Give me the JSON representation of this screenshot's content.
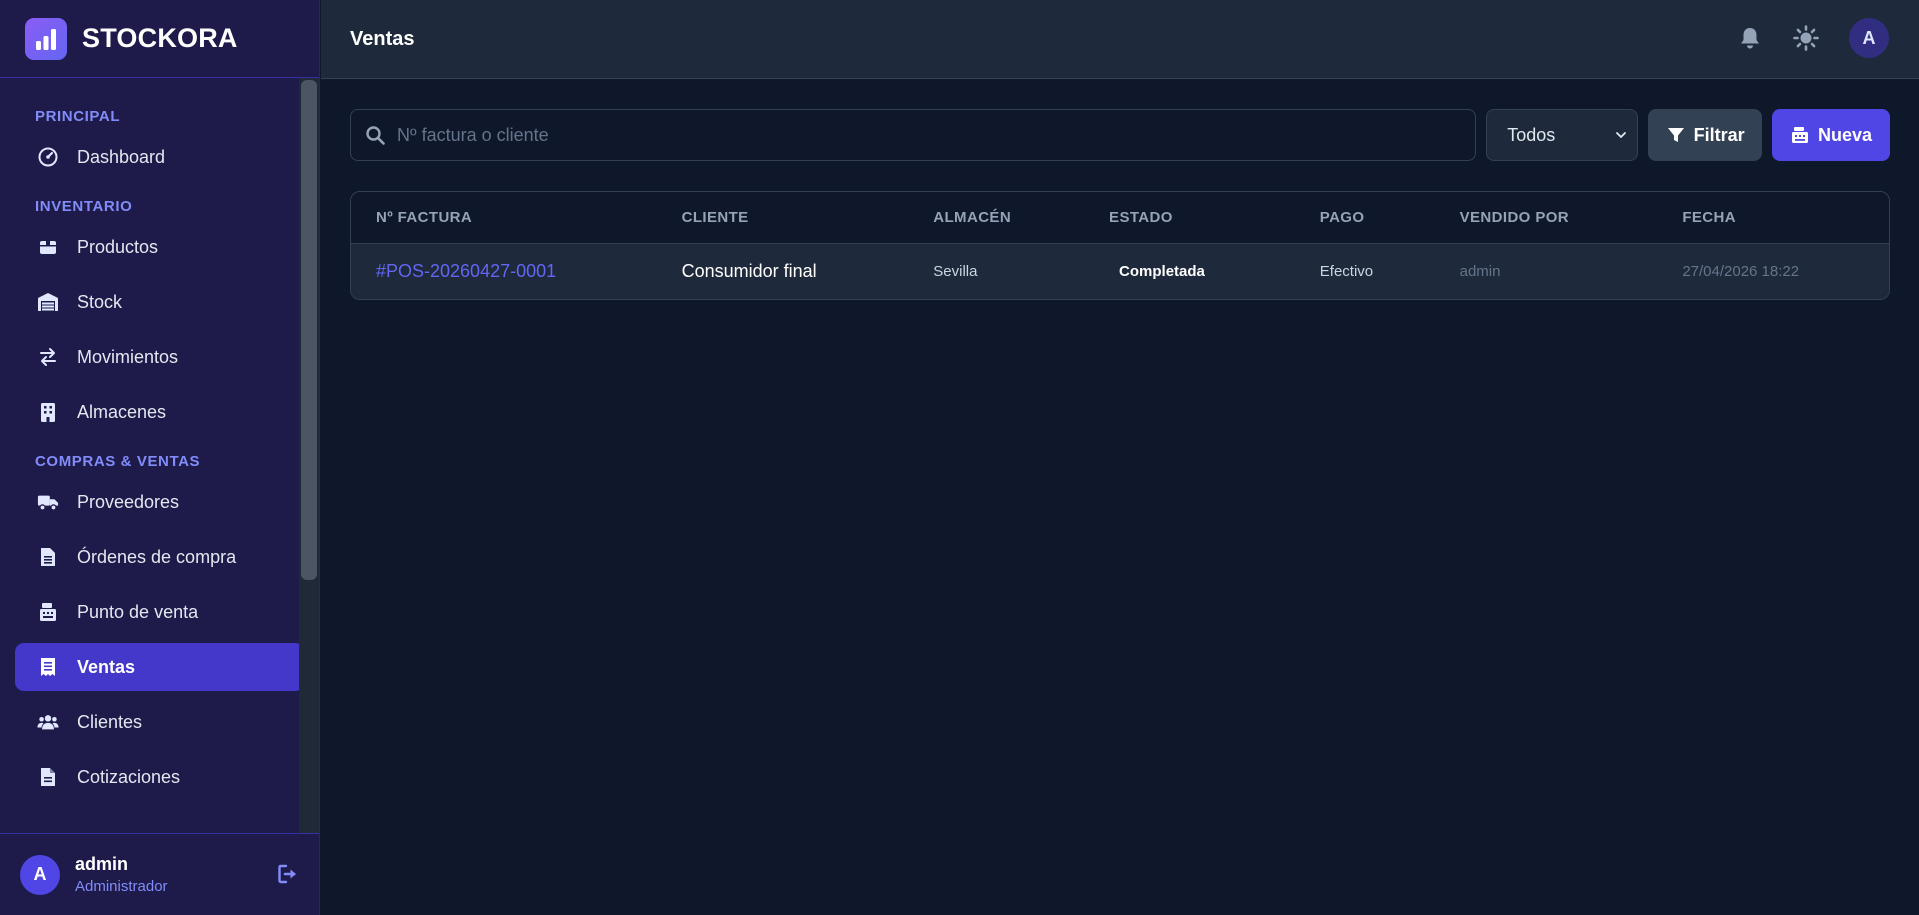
{
  "brand": {
    "name": "STOCKORA"
  },
  "sidebar": {
    "sections": [
      {
        "title": "PRINCIPAL",
        "items": [
          {
            "label": "Dashboard",
            "icon": "gauge-icon"
          }
        ]
      },
      {
        "title": "INVENTARIO",
        "items": [
          {
            "label": "Productos",
            "icon": "box-icon"
          },
          {
            "label": "Stock",
            "icon": "warehouse-icon"
          },
          {
            "label": "Movimientos",
            "icon": "arrows-exchange-icon"
          },
          {
            "label": "Almacenes",
            "icon": "building-icon"
          }
        ]
      },
      {
        "title": "COMPRAS & VENTAS",
        "items": [
          {
            "label": "Proveedores",
            "icon": "truck-icon"
          },
          {
            "label": "Órdenes de compra",
            "icon": "document-icon"
          },
          {
            "label": "Punto de venta",
            "icon": "cash-register-icon"
          },
          {
            "label": "Ventas",
            "icon": "receipt-icon",
            "active": true
          },
          {
            "label": "Clientes",
            "icon": "users-icon"
          },
          {
            "label": "Cotizaciones",
            "icon": "file-icon"
          }
        ]
      }
    ]
  },
  "user": {
    "initial": "A",
    "name": "admin",
    "role": "Administrador"
  },
  "topbar": {
    "title": "Ventas",
    "avatar_initial": "A"
  },
  "toolbar": {
    "search_placeholder": "Nº factura o cliente",
    "status_select": "Todos",
    "filter_label": "Filtrar",
    "new_label": "Nueva"
  },
  "table": {
    "headers": [
      "Nº FACTURA",
      "CLIENTE",
      "ALMACÉN",
      "ESTADO",
      "PAGO",
      "VENDIDO POR",
      "FECHA"
    ],
    "rows": [
      {
        "invoice": "#POS-20260427-0001",
        "client": "Consumidor final",
        "warehouse": "Sevilla",
        "status": "Completada",
        "payment": "Efectivo",
        "seller": "admin",
        "date": "27/04/2026 18:22"
      }
    ]
  },
  "colors": {
    "sidebar_bg": "#1e1b4b",
    "accent": "#4f46e5",
    "active_item": "#4338ca",
    "content_bg": "#0f172a",
    "link": "#6366f1"
  }
}
